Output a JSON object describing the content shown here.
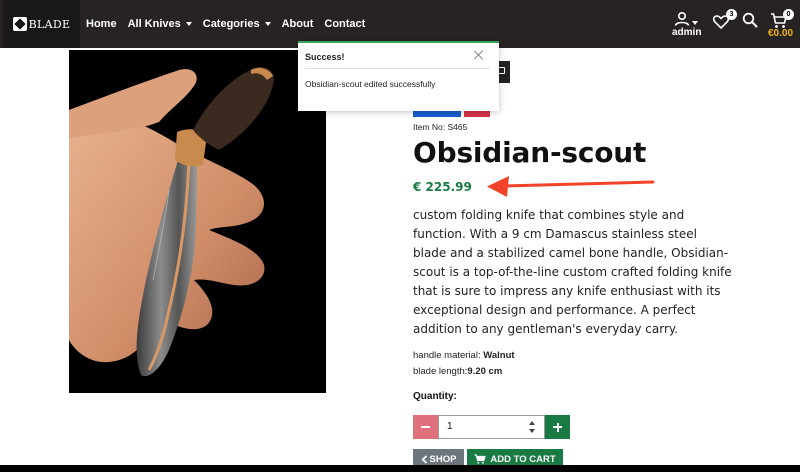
{
  "navbar": {
    "brand": "BLADE",
    "links": [
      {
        "label": "Home",
        "dropdown": false
      },
      {
        "label": "All Knives",
        "dropdown": true
      },
      {
        "label": "Categories",
        "dropdown": true
      },
      {
        "label": "About",
        "dropdown": false
      },
      {
        "label": "Contact",
        "dropdown": false
      }
    ],
    "user_name": "admin",
    "wishlist_count": "3",
    "cart_count": "0",
    "cart_total": "€0.00"
  },
  "toast": {
    "title": "Success!",
    "message": "Obsidian-scout edited successfully",
    "accent_color": "#3aa35b"
  },
  "product": {
    "item_no": "Item No: S465",
    "name": "Obsidian-scout",
    "price": "€ 225.99",
    "description": "custom folding knife that combines style and function. With a 9 cm Damascus stainless steel blade and a stabilized camel bone handle, Obsidian-scout is a top-of-the-line custom crafted folding knife that is sure to impress any knife enthusiast with its exceptional design and performance. A perfect addition to any gentleman's everyday carry.",
    "specs": [
      {
        "label": "handle material: ",
        "value": "Walnut"
      },
      {
        "label": "blade length:",
        "value": "9.20 cm"
      }
    ],
    "quantity_label": "Quantity:",
    "quantity": "1"
  },
  "buttons": {
    "shop": "SHOP",
    "add_to_cart": "ADD TO CART"
  },
  "icons": {
    "brand": "blade-logo-icon",
    "user": "user-icon",
    "wishlist": "heart-icon",
    "search": "search-icon",
    "cart": "cart-icon",
    "close": "close-icon",
    "arrow": "red-annotation-arrow-icon"
  },
  "colors": {
    "navbar": "#262322",
    "price": "#1a7a43",
    "cart_total": "#f5b50b",
    "minus": "#e0707c",
    "plus": "#1a7a43",
    "annotation_arrow": "#f2432a"
  }
}
